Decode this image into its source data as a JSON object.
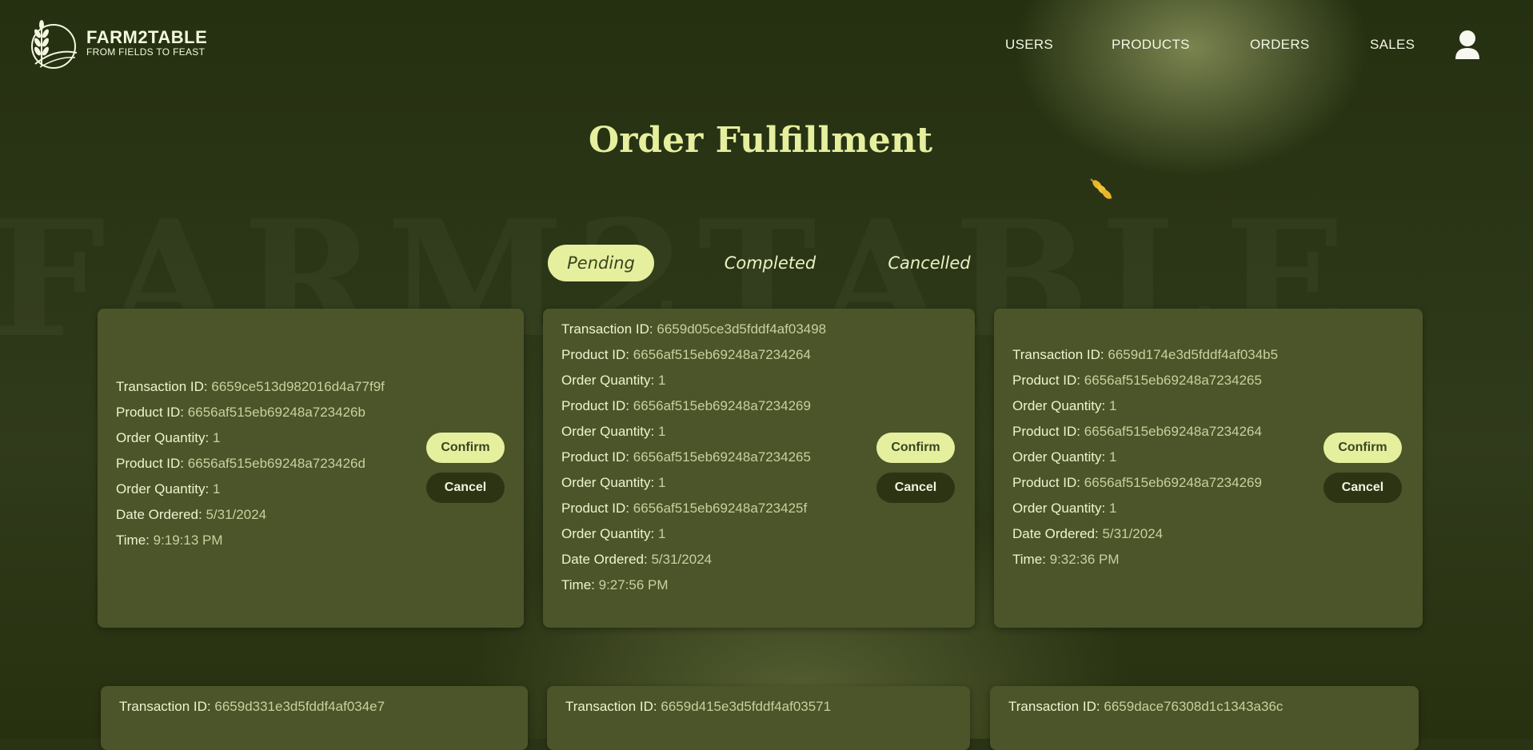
{
  "brand": {
    "title": "FARM2TABLE",
    "subtitle": "FROM FIELDS TO FEAST"
  },
  "nav": {
    "items": [
      "USERS",
      "PRODUCTS",
      "ORDERS",
      "SALES"
    ]
  },
  "page": {
    "title": "Order Fulfillment",
    "watermark": "FARM2TABLE"
  },
  "tabs": [
    "Pending",
    "Completed",
    "Cancelled"
  ],
  "active_tab": "Pending",
  "labels": {
    "transaction": "Transaction ID:",
    "product": "Product ID:",
    "quantity": "Order Quantity:",
    "date": "Date Ordered:",
    "time": "Time:"
  },
  "buttons": {
    "confirm": "Confirm",
    "cancel": "Cancel"
  },
  "orders": [
    {
      "transaction_id": "6659ce513d982016d4a77f9f",
      "items": [
        {
          "product_id": "6656af515eb69248a723426b",
          "quantity": "1"
        },
        {
          "product_id": "6656af515eb69248a723426d",
          "quantity": "1"
        }
      ],
      "date": "5/31/2024",
      "time": "9:19:13 PM"
    },
    {
      "transaction_id": "6659d05ce3d5fddf4af03498",
      "items": [
        {
          "product_id": "6656af515eb69248a7234264",
          "quantity": "1"
        },
        {
          "product_id": "6656af515eb69248a7234269",
          "quantity": "1"
        },
        {
          "product_id": "6656af515eb69248a7234265",
          "quantity": "1"
        },
        {
          "product_id": "6656af515eb69248a723425f",
          "quantity": "1"
        }
      ],
      "date": "5/31/2024",
      "time": "9:27:56 PM"
    },
    {
      "transaction_id": "6659d174e3d5fddf4af034b5",
      "items": [
        {
          "product_id": "6656af515eb69248a7234265",
          "quantity": "1"
        },
        {
          "product_id": "6656af515eb69248a7234264",
          "quantity": "1"
        },
        {
          "product_id": "6656af515eb69248a7234269",
          "quantity": "1"
        }
      ],
      "date": "5/31/2024",
      "time": "9:32:36 PM"
    },
    {
      "transaction_id": "6659d331e3d5fddf4af034e7"
    },
    {
      "transaction_id": "6659d415e3d5fddf4af03571"
    },
    {
      "transaction_id": "6659dace76308d1c1343a36c"
    }
  ]
}
